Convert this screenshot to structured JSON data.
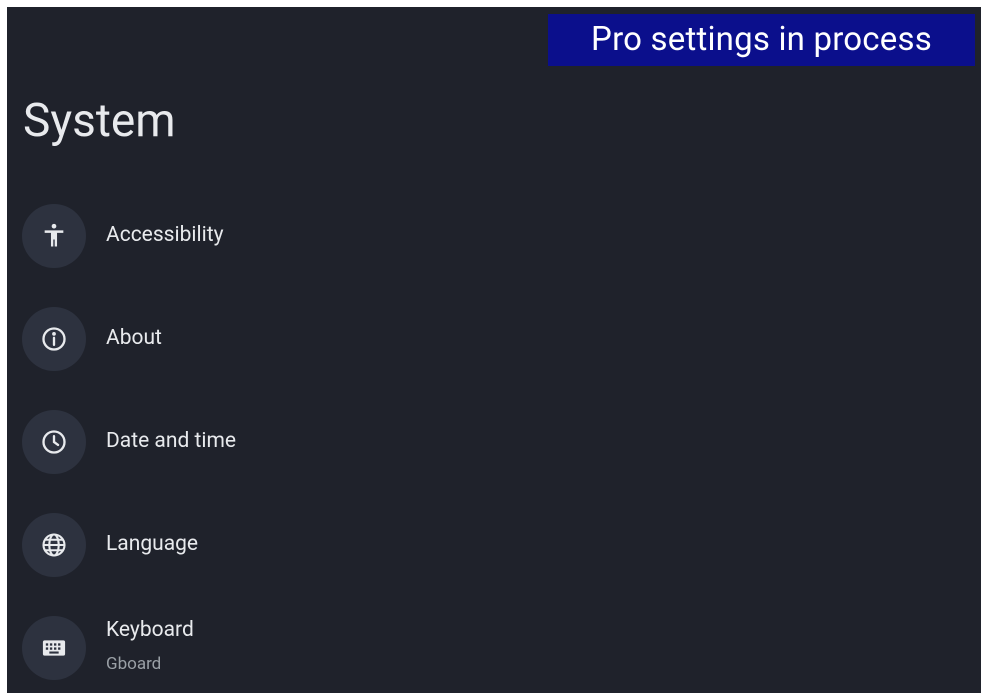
{
  "banner": {
    "text": "Pro settings in process",
    "color": "#0b0f8c"
  },
  "page": {
    "title": "System",
    "background": "#1f222b"
  },
  "items": [
    {
      "label": "Accessibility",
      "icon": "accessibility-icon"
    },
    {
      "label": "About",
      "icon": "info-icon"
    },
    {
      "label": "Date and time",
      "icon": "clock-icon"
    },
    {
      "label": "Language",
      "icon": "globe-icon"
    },
    {
      "label": "Keyboard",
      "subtitle": "Gboard",
      "icon": "keyboard-icon"
    }
  ]
}
